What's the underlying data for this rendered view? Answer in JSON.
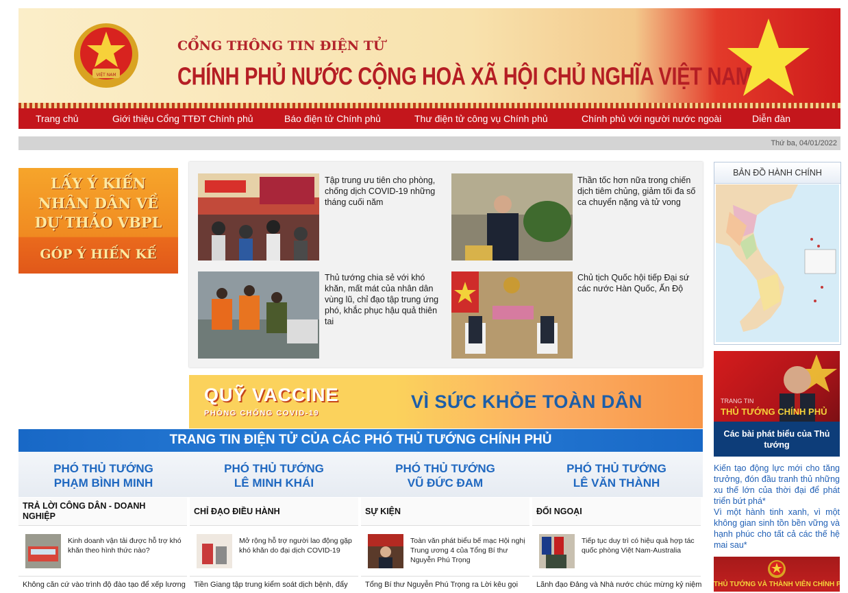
{
  "header": {
    "line1": "CỔNG THÔNG TIN ĐIỆN TỬ",
    "line2": "CHÍNH PHỦ NƯỚC CỘNG HOÀ XÃ HỘI CHỦ NGHĨA VIỆT NAM",
    "emblem_icon": "national-emblem-icon",
    "flag_icon": "vietnam-flag-star-icon"
  },
  "nav": [
    "Trang chủ",
    "Giới thiệu Cổng TTĐT Chính phủ",
    "Báo điện tử Chính phủ",
    "Thư điện tử công vụ Chính phủ",
    "Chính phủ với người nước ngoài",
    "Diễn đàn"
  ],
  "date": "Thứ ba, 04/01/2022",
  "feedback_banner": {
    "line1": "LẤY Ý KIẾN",
    "line2": "NHÂN DÂN VỀ",
    "line3": "DỰ THẢO VBPL",
    "line4": "GÓP Ý HIẾN KẾ"
  },
  "news": [
    {
      "title": "Tập trung ưu tiên cho phòng, chống dịch COVID-19 những tháng cuối năm",
      "image": "supermarket-crowd-photo"
    },
    {
      "title": "Thần tốc hơn nữa trong chiến dịch tiêm chủng, giảm tối đa số ca chuyển nặng và tử vong",
      "image": "prime-minister-speaking-photo"
    },
    {
      "title": "Thủ tướng chia sẻ với khó khăn, mất mát của nhân dân vùng lũ, chỉ đạo tập trung ứng phó, khắc phục hậu quả thiên tai",
      "image": "flood-rescue-photo"
    },
    {
      "title": "Chủ tịch Quốc hội tiếp Đại sứ các nước Hàn Quốc, Ấn Độ",
      "image": "diplomatic-meeting-photo"
    }
  ],
  "vaccine_banner": {
    "title": "QUỸ VACCINE",
    "subtitle": "PHÒNG CHỐNG COVID-19",
    "slogan": "VÌ SỨC KHỎE TOÀN DÂN"
  },
  "deputy": {
    "title": "TRANG TIN ĐIỆN TỬ CỦA CÁC PHÓ THỦ TƯỚNG CHÍNH PHỦ",
    "items": [
      {
        "role": "PHÓ THỦ TƯỚNG",
        "name": "PHẠM BÌNH MINH"
      },
      {
        "role": "PHÓ THỦ TƯỚNG",
        "name": "LÊ MINH KHÁI"
      },
      {
        "role": "PHÓ THỦ TƯỚNG",
        "name": "VŨ ĐỨC ĐAM"
      },
      {
        "role": "PHÓ THỦ TƯỚNG",
        "name": "LÊ VĂN THÀNH"
      }
    ]
  },
  "categories": [
    {
      "label": "TRẢ LỜI CÔNG DÂN - DOANH NGHIỆP",
      "item": "Kinh doanh vận tải được hỗ trợ khó khăn theo hình thức nào?",
      "more": "Không căn cứ vào trình độ đào tạo để xếp lương"
    },
    {
      "label": "CHỈ ĐẠO ĐIỀU HÀNH",
      "item": "Mở rộng hỗ trợ người lao động gặp khó khăn do đại dịch COVID-19",
      "more": "Tiền Giang tập trung kiểm soát dịch bệnh, đẩy"
    },
    {
      "label": "SỰ KIỆN",
      "item": "Toàn văn phát biểu bế mạc Hội nghị Trung ương 4 của Tổng Bí thư Nguyễn Phú Trọng",
      "more": "Tổng Bí thư Nguyễn Phú Trọng ra Lời kêu gọi"
    },
    {
      "label": "ĐỐI NGOẠI",
      "item": "Tiếp tục duy trì có hiệu quả hợp tác quốc phòng Việt Nam-Australia",
      "more": "Lãnh đạo Đảng và Nhà nước chúc mừng kỷ niệm"
    }
  ],
  "sidebar": {
    "map_title": "BẢN ĐỒ HÀNH CHÍNH",
    "pm_promo_small": "TRANG TIN",
    "pm_promo_big": "THỦ TƯỚNG CHÍNH PHỦ",
    "pm_caption": "Các bài phát biểu của Thủ tướng",
    "pm_links": [
      "Kiến tạo động lực mới cho tăng trưởng, đón đầu tranh thủ những xu thế lớn của thời đại để phát triển bứt phá*",
      "Vì một hành tinh xanh, vì một không gian sinh tồn bền vững và hạnh phúc cho tất cả các thế hệ mai sau*"
    ],
    "members_banner": "THỦ TƯỚNG VÀ THÀNH VIÊN CHÍNH PHỦ"
  },
  "colors": {
    "nav_red": "#c4161c",
    "deputy_blue": "#1868c6",
    "link_blue": "#1f5fb5",
    "caption_navy": "#0d3d79"
  }
}
